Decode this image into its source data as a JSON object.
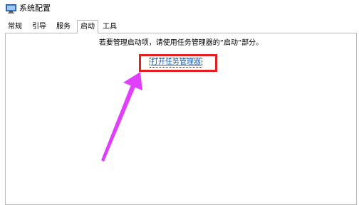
{
  "window": {
    "title": "系统配置",
    "icon": "msconfig-icon"
  },
  "tabs": [
    {
      "label": "常规",
      "active": false
    },
    {
      "label": "引导",
      "active": false
    },
    {
      "label": "服务",
      "active": false
    },
    {
      "label": "启动",
      "active": true
    },
    {
      "label": "工具",
      "active": false
    }
  ],
  "startup": {
    "info_text": "若要管理启动项，请使用任务管理器的“启动”部分。",
    "link_label": "打开任务管理器"
  },
  "annotation": {
    "highlight_color": "#e31e1e",
    "arrow_color": "#e040fb"
  }
}
